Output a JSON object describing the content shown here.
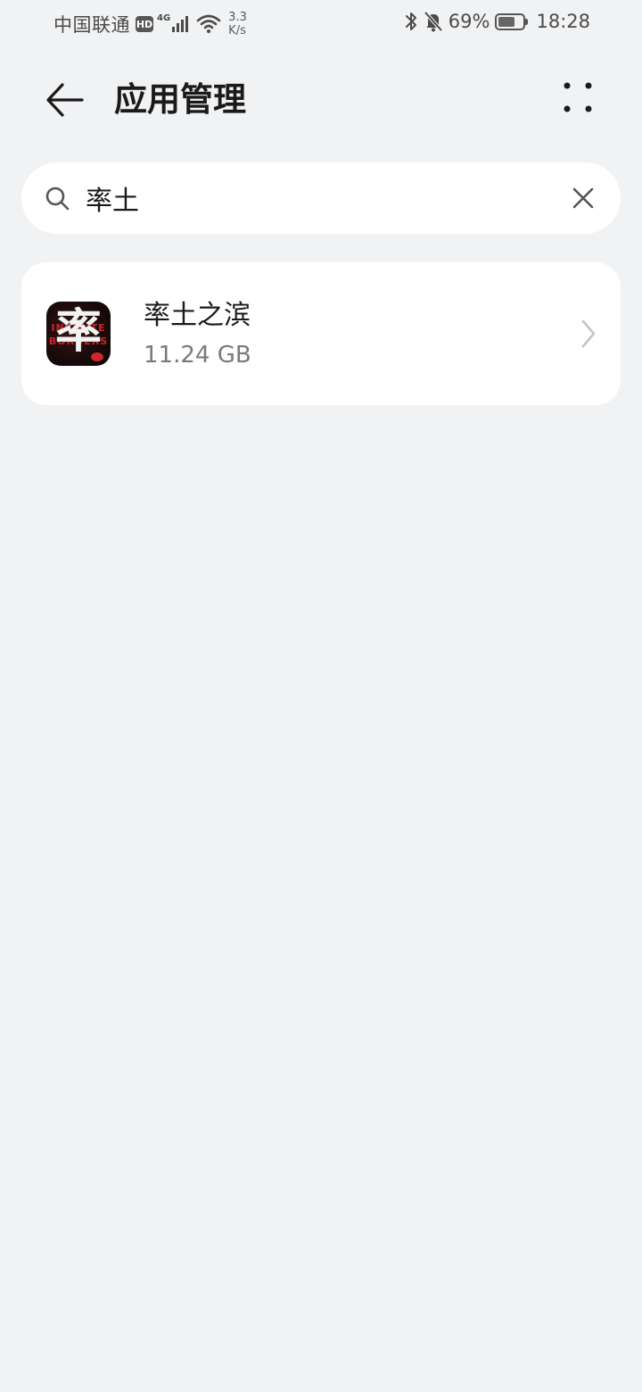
{
  "status_bar": {
    "carrier": "中国联通",
    "hd_badge": "HD",
    "network_gen": "4G",
    "net_speed_value": "3.3",
    "net_speed_unit": "K/s",
    "battery_percent_text": "69%",
    "battery_level": 0.69,
    "time": "18:28",
    "icons": [
      "signal-bars-icon",
      "wifi-icon",
      "bluetooth-icon",
      "bell-muted-icon",
      "battery-icon"
    ]
  },
  "header": {
    "title": "应用管理",
    "back_icon": "arrow-left-icon",
    "more_icon": "more-dots-icon"
  },
  "search": {
    "value": "率土",
    "placeholder": "",
    "clear_icon": "close-icon"
  },
  "results": [
    {
      "name": "率土之滨",
      "size": "11.24 GB",
      "icon_glyph": "率",
      "icon_text_1": "INFINITE",
      "icon_text_2": "BORDERS"
    }
  ],
  "colors": {
    "background": "#f1f2f4",
    "card": "#ffffff",
    "title_text": "#1a1a1a",
    "secondary_text": "#7a7a7a"
  }
}
